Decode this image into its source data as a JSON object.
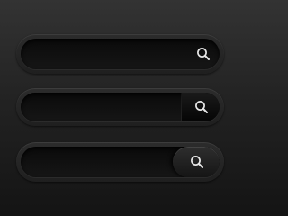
{
  "search_bars": [
    {
      "placeholder": "",
      "value": "",
      "icon": "search-icon"
    },
    {
      "placeholder": "",
      "value": "",
      "icon": "search-icon"
    },
    {
      "placeholder": "",
      "value": "",
      "icon": "search-icon"
    }
  ],
  "colors": {
    "background_top": "#333333",
    "background_bottom": "#141414",
    "field": "#0f0f0f",
    "icon": "#e6e6e6"
  }
}
